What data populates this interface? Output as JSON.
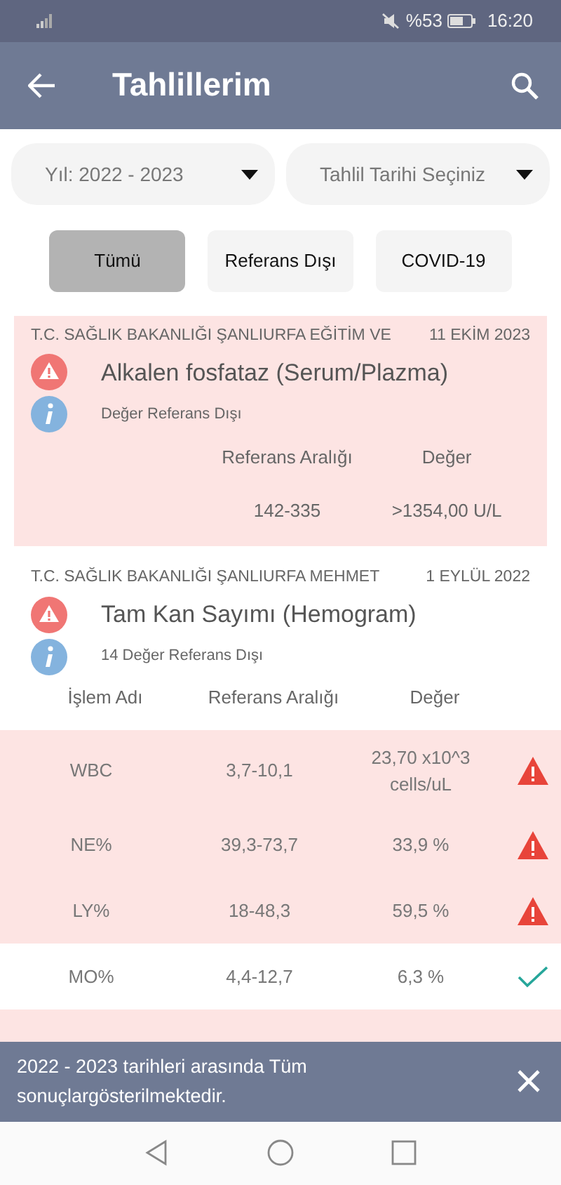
{
  "status_bar": {
    "battery": "%53",
    "time": "16:20"
  },
  "app_bar": {
    "title": "Tahlillerim"
  },
  "dropdowns": [
    {
      "label": "Yıl: 2022 - 2023"
    },
    {
      "label": "Tahlil Tarihi Seçiniz"
    }
  ],
  "filters": [
    {
      "label": "Tümü",
      "selected": true
    },
    {
      "label": "Referans Dışı",
      "selected": false
    },
    {
      "label": "COVID-19",
      "selected": false
    }
  ],
  "results": [
    {
      "hospital": "T.C. SAĞLIK BAKANLIĞI ŞANLIURFA EĞİTİM VE",
      "date": "11 EKİM 2023",
      "test": "Alkalen fosfataz (Serum/Plazma)",
      "note": "Değer Referans Dışı",
      "out_of_range": true,
      "columns": [
        "Referans Aralığı",
        "Değer"
      ],
      "rows": [
        {
          "range": "142-335",
          "value": ">1354,00 U/L"
        }
      ]
    },
    {
      "hospital": "T.C. SAĞLIK BAKANLIĞI ŞANLIURFA MEHMET",
      "date": "1 EYLÜL 2022",
      "test": "Tam Kan Sayımı (Hemogram)",
      "note": "14 Değer Referans Dışı",
      "out_of_range": false,
      "columns": [
        "İşlem Adı",
        "Referans Aralığı",
        "Değer"
      ],
      "rows": [
        {
          "name": "WBC",
          "range": "3,7-10,1",
          "value": "23,70 x10^3 cells/uL",
          "out_of_range": true
        },
        {
          "name": "NE%",
          "range": "39,3-73,7",
          "value": "33,9 %",
          "out_of_range": true
        },
        {
          "name": "LY%",
          "range": "18-48,3",
          "value": "59,5 %",
          "out_of_range": true
        },
        {
          "name": "MO%",
          "range": "4,4-12,7",
          "value": "6,3 %",
          "out_of_range": false
        },
        {
          "out_of_range": true
        }
      ]
    }
  ],
  "snackbar": {
    "message": "2022 - 2023 tarihleri arasında Tüm sonuçlargösterilmektedir."
  }
}
